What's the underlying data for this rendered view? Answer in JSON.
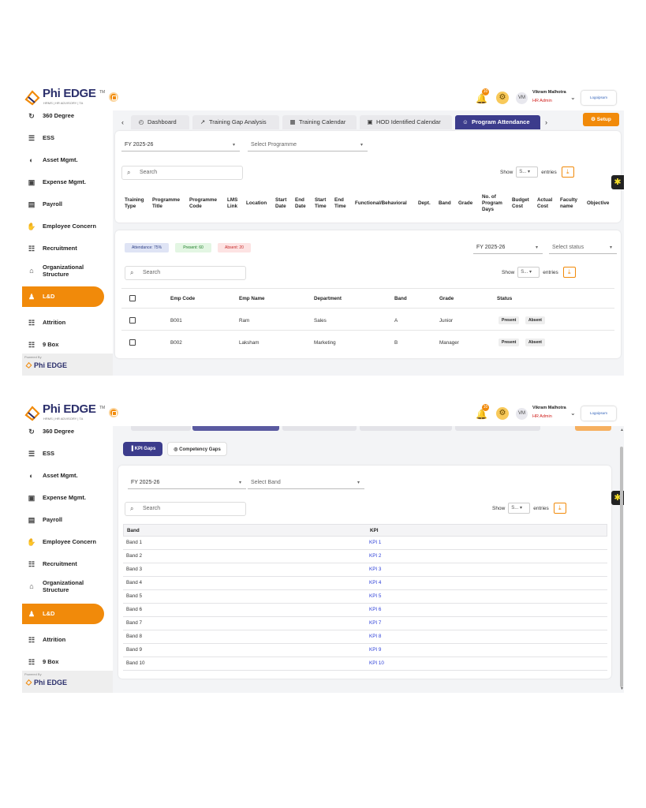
{
  "brand": {
    "name_a": "Phi",
    "name_b": "EDGE",
    "tagline": "HRMS | HR ADVISORY | TA",
    "trademark": "TM",
    "powered_by": "Powered By",
    "accent": "#f18a0a",
    "navy": "#3c3c8c"
  },
  "header": {
    "notif_count": "10",
    "avatar": "VM",
    "user_name": "Vikram Malhotra",
    "user_role": "HR Admin",
    "company_logo": "Logoipsum"
  },
  "sidebar": {
    "items": [
      {
        "label": "360 Degree",
        "icon": "360-icon"
      },
      {
        "label": "ESS",
        "icon": "ess-icon"
      },
      {
        "label": "Asset Mgmt.",
        "icon": "asset-icon"
      },
      {
        "label": "Expense Mgmt.",
        "icon": "expense-icon"
      },
      {
        "label": "Payroll",
        "icon": "payroll-icon"
      },
      {
        "label": "Employee Concern",
        "icon": "concern-icon"
      },
      {
        "label": "Recruitment",
        "icon": "recruitment-icon"
      },
      {
        "label": "Organizational Structure",
        "icon": "org-icon"
      },
      {
        "label": "L&D",
        "icon": "ld-icon"
      },
      {
        "label": "Attrition",
        "icon": "attrition-icon"
      },
      {
        "label": "9 Box",
        "icon": "ninebox-icon"
      }
    ]
  },
  "screen1": {
    "tabs": [
      {
        "label": "Dashboard"
      },
      {
        "label": "Training Gap Analysis"
      },
      {
        "label": "Training Calendar"
      },
      {
        "label": "HOD Identified Calendar"
      },
      {
        "label": "Program Attendance"
      }
    ],
    "setup": "Setup",
    "fy": "FY 2025-26",
    "programme_placeholder": "Select Programme",
    "search_placeholder": "Search",
    "show": "Show",
    "show_value": "S...",
    "entries": "entries",
    "columns": [
      "Training Type",
      "Programme Title",
      "Programme Code",
      "LMS Link",
      "Location",
      "Start Date",
      "End Date",
      "Start Time",
      "End Time",
      "Functional/Behavioral",
      "Dept.",
      "Band",
      "Grade",
      "No. of Program Days",
      "Budget Cost",
      "Actual Cost",
      "Faculty name",
      "Objective"
    ],
    "attendance": {
      "attendance_badge": "Attendance: 75%",
      "present_badge": "Present: 60",
      "absent_badge": "Absent: 20",
      "fy": "FY 2025-26",
      "status_placeholder": "Select status",
      "search_placeholder": "Search",
      "show": "Show",
      "show_value": "S...",
      "entries": "entries",
      "columns": [
        "Emp Code",
        "Emp Name",
        "Department",
        "Band",
        "Grade",
        "Status"
      ],
      "rows": [
        {
          "code": "B001",
          "name": "Ram",
          "dept": "Sales",
          "band": "A",
          "grade": "Junior",
          "present": "Present",
          "absent": "Absent"
        },
        {
          "code": "B002",
          "name": "Laksham",
          "dept": "Marketing",
          "band": "B",
          "grade": "Manager",
          "present": "Present",
          "absent": "Absent"
        }
      ]
    }
  },
  "screen2": {
    "kpi_gaps": "KPI Gaps",
    "competency_gaps": "Competency Gaps",
    "fy": "FY 2025-26",
    "band_placeholder": "Select Band",
    "search_placeholder": "Search",
    "show": "Show",
    "show_value": "S...",
    "entries": "entries",
    "columns": [
      "Band",
      "KPI"
    ],
    "rows": [
      {
        "band": "Band 1",
        "kpi": "KPI 1"
      },
      {
        "band": "Band 2",
        "kpi": "KPI 2"
      },
      {
        "band": "Band 3",
        "kpi": "KPI 3"
      },
      {
        "band": "Band 4",
        "kpi": "KPI 4"
      },
      {
        "band": "Band 5",
        "kpi": "KPI 5"
      },
      {
        "band": "Band 6",
        "kpi": "KPI 6"
      },
      {
        "band": "Band 7",
        "kpi": "KPI 7"
      },
      {
        "band": "Band 8",
        "kpi": "KPI 8"
      },
      {
        "band": "Band 9",
        "kpi": "KPI 9"
      },
      {
        "band": "Band 10",
        "kpi": "KPI 10"
      }
    ]
  }
}
